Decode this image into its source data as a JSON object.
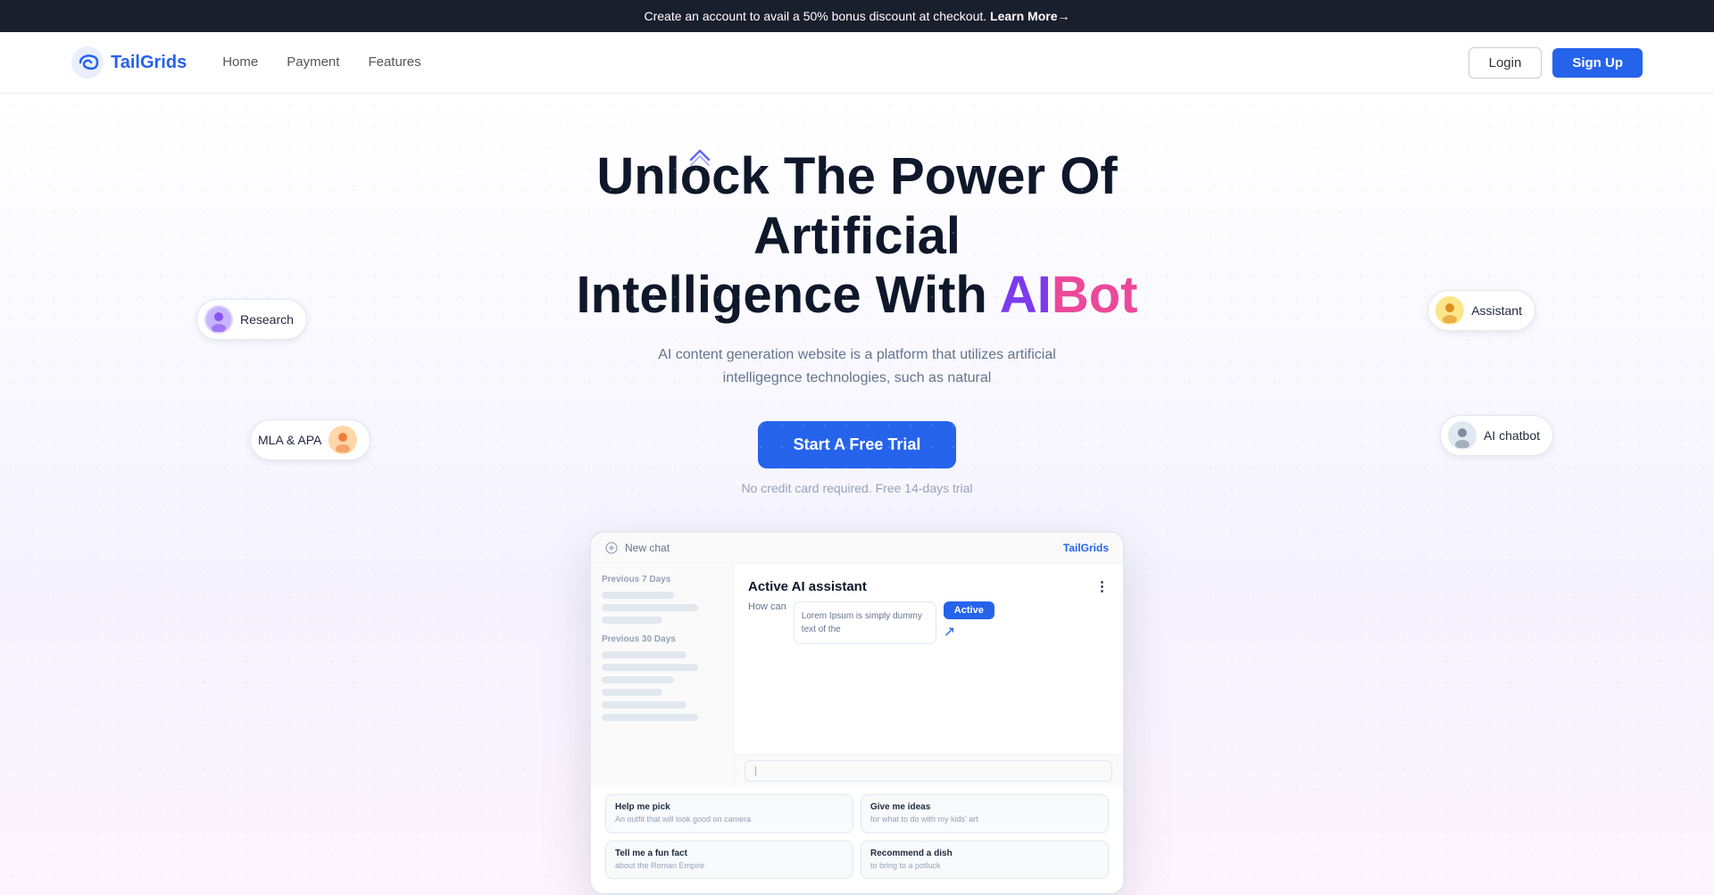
{
  "banner": {
    "text": "Create an account to avail a 50% bonus discount at checkout.",
    "link_text": "Learn More→"
  },
  "navbar": {
    "logo_text": "TailGrids",
    "nav_links": [
      {
        "label": "Home",
        "href": "#"
      },
      {
        "label": "Payment",
        "href": "#"
      },
      {
        "label": "Features",
        "href": "#"
      }
    ],
    "login_label": "Login",
    "signup_label": "Sign Up"
  },
  "hero": {
    "headline_1": "Unlock The Power Of Artificial",
    "headline_2": "Intelligence With ",
    "headline_ai": "AI",
    "headline_bot": "Bot",
    "subtext": "AI content generation website is a platform that utilizes artificial intelligegnce technologies, such as natural",
    "cta_button": "Start A Free Trial",
    "cta_note": "No credit card required. Free 14-days trial"
  },
  "badges": {
    "research": {
      "label": "Research"
    },
    "mla": {
      "label": "MLA & APA"
    },
    "assistant": {
      "label": "Assistant"
    },
    "chatbot": {
      "label": "AI chatbot"
    }
  },
  "mockup": {
    "topbar_left": "New chat",
    "topbar_right": "TailGrids",
    "sidebar_section1": "Previous 7 Days",
    "sidebar_section2": "Previous 30 Days",
    "chat_title": "Active AI assistant",
    "lorem_text": "Lorem Ipsum is simply dummy text of the",
    "active_label": "Active",
    "how_can": "How can",
    "grid_cards": [
      {
        "title": "Help me pick",
        "sub": "An outfit that will look good on camera"
      },
      {
        "title": "Give me ideas",
        "sub": "for what to do with my kids' art"
      },
      {
        "title": "Tell me a fun fact",
        "sub": "about the Roman Empire"
      },
      {
        "title": "Recommend a dish",
        "sub": "to bring to a potluck"
      }
    ]
  },
  "colors": {
    "accent_blue": "#2563eb",
    "accent_purple": "#7c3aed",
    "accent_pink": "#ec4899",
    "dark": "#0f172a"
  }
}
